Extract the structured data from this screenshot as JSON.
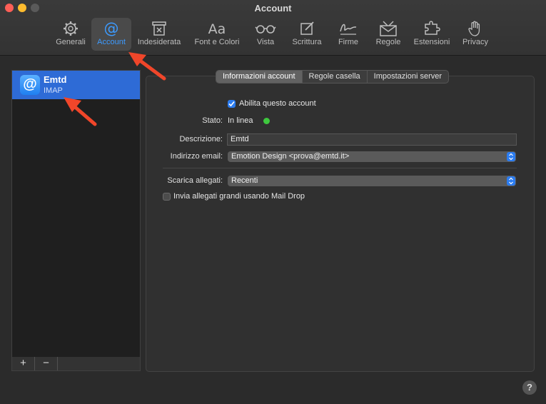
{
  "window": {
    "title": "Account"
  },
  "toolbar": {
    "items": [
      {
        "label": "Generali"
      },
      {
        "label": "Account"
      },
      {
        "label": "Indesiderata"
      },
      {
        "label": "Font e Colori"
      },
      {
        "label": "Vista"
      },
      {
        "label": "Scrittura"
      },
      {
        "label": "Firme"
      },
      {
        "label": "Regole"
      },
      {
        "label": "Estensioni"
      },
      {
        "label": "Privacy"
      }
    ],
    "active": "Account"
  },
  "sidebar": {
    "accounts": [
      {
        "name": "Emtd",
        "type": "IMAP",
        "icon": "@"
      }
    ],
    "add_label": "+",
    "remove_label": "−"
  },
  "tabs": [
    {
      "label": "Informazioni account"
    },
    {
      "label": "Regole casella"
    },
    {
      "label": "Impostazioni server"
    }
  ],
  "form": {
    "enable_label": "Abilita questo account",
    "enable_checked": true,
    "status_label": "Stato:",
    "status_value": "In linea",
    "description_label": "Descrizione:",
    "description_value": "Emtd",
    "email_label": "Indirizzo email:",
    "email_value": "Emotion Design <prova@emtd.it>",
    "attachments_label": "Scarica allegati:",
    "attachments_value": "Recenti",
    "maildrop_label": "Invia allegati grandi usando Mail Drop",
    "maildrop_checked": false
  },
  "help_label": "?",
  "colors": {
    "accent": "#2b7cf0",
    "status_ok": "#3ec83e",
    "annotation": "#f0462a"
  }
}
